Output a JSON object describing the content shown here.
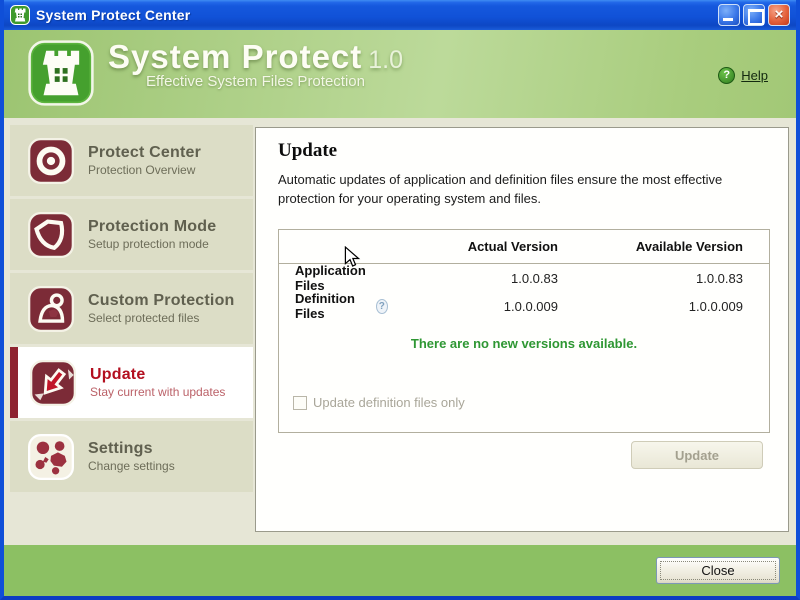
{
  "window": {
    "title": "System Protect Center"
  },
  "titlebar_controls": {
    "minimize": "minimize",
    "maximize": "maximize",
    "close_glyph": "×"
  },
  "header": {
    "app_name": "System Protect",
    "version": "1.0",
    "tagline": "Effective System Files Protection",
    "help_label": "Help",
    "help_icon_glyph": "?"
  },
  "sidebar": {
    "items": [
      {
        "title": "Protect Center",
        "subtitle": "Protection Overview",
        "icon": "target-icon",
        "selected": false
      },
      {
        "title": "Protection Mode",
        "subtitle": "Setup protection mode",
        "icon": "shield-icon",
        "selected": false
      },
      {
        "title": "Custom Protection",
        "subtitle": "Select protected files",
        "icon": "user-files-icon",
        "selected": false
      },
      {
        "title": "Update",
        "subtitle": "Stay current with updates",
        "icon": "download-arrow-icon",
        "selected": true
      },
      {
        "title": "Settings",
        "subtitle": "Change settings",
        "icon": "gears-icon",
        "selected": false
      }
    ]
  },
  "main": {
    "title": "Update",
    "description": "Automatic updates of application and definition files ensure the most effective protection for your operating system and files.",
    "table": {
      "col_actual": "Actual Version",
      "col_available": "Available Version",
      "rows": [
        {
          "label": "Application Files",
          "actual": "1.0.0.83",
          "available": "1.0.0.83",
          "has_help_icon": false
        },
        {
          "label": "Definition Files",
          "actual": "1.0.0.009",
          "available": "1.0.0.009",
          "has_help_icon": true
        }
      ],
      "help_icon_glyph": "?"
    },
    "status_message": "There are no new versions available.",
    "checkbox_label": "Update definition files only",
    "checkbox_checked": false,
    "update_button_label": "Update",
    "update_button_enabled": false
  },
  "footer": {
    "close_label": "Close"
  },
  "colors": {
    "titlebar_blue": "#1257da",
    "header_green": "#aacd80",
    "footer_green": "#8cc063",
    "sidebar_bg": "#dcddc6",
    "icon_maroon": "#7c2b37",
    "selected_red": "#b30f1f",
    "status_green": "#2e9733"
  }
}
